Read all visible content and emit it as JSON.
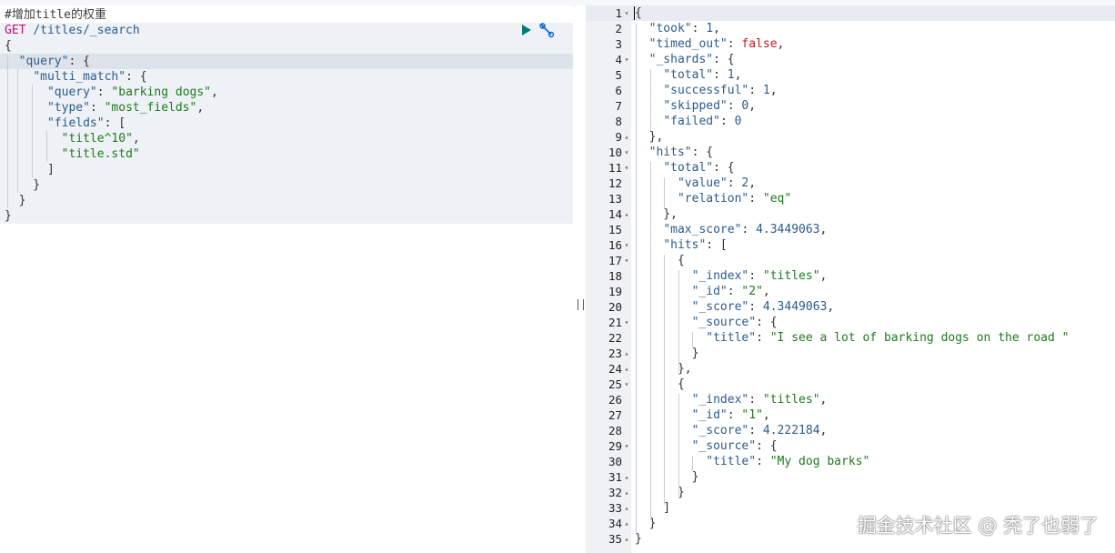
{
  "request": {
    "comment": "#增加title的权重",
    "method": "GET",
    "path": "/titles/_search",
    "body": [
      {
        "t": [
          [
            "{",
            "punc"
          ]
        ]
      },
      {
        "t": [
          [
            "  ",
            "punc"
          ],
          [
            "\"query\"",
            "key"
          ],
          [
            ": {",
            "punc"
          ]
        ]
      },
      {
        "t": [
          [
            "    ",
            "punc"
          ],
          [
            "\"multi_match\"",
            "key"
          ],
          [
            ": {",
            "punc"
          ]
        ]
      },
      {
        "t": [
          [
            "      ",
            "punc"
          ],
          [
            "\"query\"",
            "key"
          ],
          [
            ": ",
            "punc"
          ],
          [
            "\"barking dogs\"",
            "str"
          ],
          [
            ",",
            "punc"
          ]
        ]
      },
      {
        "t": [
          [
            "      ",
            "punc"
          ],
          [
            "\"type\"",
            "key"
          ],
          [
            ": ",
            "punc"
          ],
          [
            "\"most_fields\"",
            "str"
          ],
          [
            ",",
            "punc"
          ]
        ]
      },
      {
        "t": [
          [
            "      ",
            "punc"
          ],
          [
            "\"fields\"",
            "key"
          ],
          [
            ": [",
            "punc"
          ]
        ]
      },
      {
        "t": [
          [
            "        ",
            "punc"
          ],
          [
            "\"title^10\"",
            "str"
          ],
          [
            ",",
            "punc"
          ]
        ]
      },
      {
        "t": [
          [
            "        ",
            "punc"
          ],
          [
            "\"title.std\"",
            "str"
          ]
        ]
      },
      {
        "t": [
          [
            "      ]",
            "punc"
          ]
        ]
      },
      {
        "t": [
          [
            "    }",
            "punc"
          ]
        ]
      },
      {
        "t": [
          [
            "  }",
            "punc"
          ]
        ]
      },
      {
        "t": [
          [
            "}",
            "punc"
          ]
        ]
      }
    ],
    "run_icon": "play-icon",
    "settings_icon": "wrench-icon"
  },
  "response": {
    "lines": [
      {
        "n": "1",
        "f": "down",
        "t": [
          [
            "{",
            "punc"
          ]
        ]
      },
      {
        "n": "2",
        "f": "",
        "t": [
          [
            "  ",
            "punc"
          ],
          [
            "\"took\"",
            "key"
          ],
          [
            ": ",
            "punc"
          ],
          [
            "1",
            "num"
          ],
          [
            ",",
            "punc"
          ]
        ]
      },
      {
        "n": "3",
        "f": "",
        "t": [
          [
            "  ",
            "punc"
          ],
          [
            "\"timed_out\"",
            "key"
          ],
          [
            ": ",
            "punc"
          ],
          [
            "false",
            "kw"
          ],
          [
            ",",
            "punc"
          ]
        ]
      },
      {
        "n": "4",
        "f": "down",
        "t": [
          [
            "  ",
            "punc"
          ],
          [
            "\"_shards\"",
            "key"
          ],
          [
            ": {",
            "punc"
          ]
        ]
      },
      {
        "n": "5",
        "f": "",
        "t": [
          [
            "    ",
            "punc"
          ],
          [
            "\"total\"",
            "key"
          ],
          [
            ": ",
            "punc"
          ],
          [
            "1",
            "num"
          ],
          [
            ",",
            "punc"
          ]
        ]
      },
      {
        "n": "6",
        "f": "",
        "t": [
          [
            "    ",
            "punc"
          ],
          [
            "\"successful\"",
            "key"
          ],
          [
            ": ",
            "punc"
          ],
          [
            "1",
            "num"
          ],
          [
            ",",
            "punc"
          ]
        ]
      },
      {
        "n": "7",
        "f": "",
        "t": [
          [
            "    ",
            "punc"
          ],
          [
            "\"skipped\"",
            "key"
          ],
          [
            ": ",
            "punc"
          ],
          [
            "0",
            "num"
          ],
          [
            ",",
            "punc"
          ]
        ]
      },
      {
        "n": "8",
        "f": "",
        "t": [
          [
            "    ",
            "punc"
          ],
          [
            "\"failed\"",
            "key"
          ],
          [
            ": ",
            "punc"
          ],
          [
            "0",
            "num"
          ]
        ]
      },
      {
        "n": "9",
        "f": "up",
        "t": [
          [
            "  },",
            "punc"
          ]
        ]
      },
      {
        "n": "10",
        "f": "down",
        "t": [
          [
            "  ",
            "punc"
          ],
          [
            "\"hits\"",
            "key"
          ],
          [
            ": {",
            "punc"
          ]
        ]
      },
      {
        "n": "11",
        "f": "down",
        "t": [
          [
            "    ",
            "punc"
          ],
          [
            "\"total\"",
            "key"
          ],
          [
            ": {",
            "punc"
          ]
        ]
      },
      {
        "n": "12",
        "f": "",
        "t": [
          [
            "      ",
            "punc"
          ],
          [
            "\"value\"",
            "key"
          ],
          [
            ": ",
            "punc"
          ],
          [
            "2",
            "num"
          ],
          [
            ",",
            "punc"
          ]
        ]
      },
      {
        "n": "13",
        "f": "",
        "t": [
          [
            "      ",
            "punc"
          ],
          [
            "\"relation\"",
            "key"
          ],
          [
            ": ",
            "punc"
          ],
          [
            "\"eq\"",
            "str"
          ]
        ]
      },
      {
        "n": "14",
        "f": "up",
        "t": [
          [
            "    },",
            "punc"
          ]
        ]
      },
      {
        "n": "15",
        "f": "",
        "t": [
          [
            "    ",
            "punc"
          ],
          [
            "\"max_score\"",
            "key"
          ],
          [
            ": ",
            "punc"
          ],
          [
            "4.3449063",
            "num"
          ],
          [
            ",",
            "punc"
          ]
        ]
      },
      {
        "n": "16",
        "f": "down",
        "t": [
          [
            "    ",
            "punc"
          ],
          [
            "\"hits\"",
            "key"
          ],
          [
            ": [",
            "punc"
          ]
        ]
      },
      {
        "n": "17",
        "f": "down",
        "t": [
          [
            "      {",
            "punc"
          ]
        ]
      },
      {
        "n": "18",
        "f": "",
        "t": [
          [
            "        ",
            "punc"
          ],
          [
            "\"_index\"",
            "key"
          ],
          [
            ": ",
            "punc"
          ],
          [
            "\"titles\"",
            "str"
          ],
          [
            ",",
            "punc"
          ]
        ]
      },
      {
        "n": "19",
        "f": "",
        "t": [
          [
            "        ",
            "punc"
          ],
          [
            "\"_id\"",
            "key"
          ],
          [
            ": ",
            "punc"
          ],
          [
            "\"2\"",
            "str"
          ],
          [
            ",",
            "punc"
          ]
        ]
      },
      {
        "n": "20",
        "f": "",
        "t": [
          [
            "        ",
            "punc"
          ],
          [
            "\"_score\"",
            "key"
          ],
          [
            ": ",
            "punc"
          ],
          [
            "4.3449063",
            "num"
          ],
          [
            ",",
            "punc"
          ]
        ]
      },
      {
        "n": "21",
        "f": "down",
        "t": [
          [
            "        ",
            "punc"
          ],
          [
            "\"_source\"",
            "key"
          ],
          [
            ": {",
            "punc"
          ]
        ]
      },
      {
        "n": "22",
        "f": "",
        "t": [
          [
            "          ",
            "punc"
          ],
          [
            "\"title\"",
            "key"
          ],
          [
            ": ",
            "punc"
          ],
          [
            "\"I see a lot of barking dogs on the road \"",
            "str"
          ]
        ]
      },
      {
        "n": "23",
        "f": "up",
        "t": [
          [
            "        }",
            "punc"
          ]
        ]
      },
      {
        "n": "24",
        "f": "up",
        "t": [
          [
            "      },",
            "punc"
          ]
        ]
      },
      {
        "n": "25",
        "f": "down",
        "t": [
          [
            "      {",
            "punc"
          ]
        ]
      },
      {
        "n": "26",
        "f": "",
        "t": [
          [
            "        ",
            "punc"
          ],
          [
            "\"_index\"",
            "key"
          ],
          [
            ": ",
            "punc"
          ],
          [
            "\"titles\"",
            "str"
          ],
          [
            ",",
            "punc"
          ]
        ]
      },
      {
        "n": "27",
        "f": "",
        "t": [
          [
            "        ",
            "punc"
          ],
          [
            "\"_id\"",
            "key"
          ],
          [
            ": ",
            "punc"
          ],
          [
            "\"1\"",
            "str"
          ],
          [
            ",",
            "punc"
          ]
        ]
      },
      {
        "n": "28",
        "f": "",
        "t": [
          [
            "        ",
            "punc"
          ],
          [
            "\"_score\"",
            "key"
          ],
          [
            ": ",
            "punc"
          ],
          [
            "4.222184",
            "num"
          ],
          [
            ",",
            "punc"
          ]
        ]
      },
      {
        "n": "29",
        "f": "down",
        "t": [
          [
            "        ",
            "punc"
          ],
          [
            "\"_source\"",
            "key"
          ],
          [
            ": {",
            "punc"
          ]
        ]
      },
      {
        "n": "30",
        "f": "",
        "t": [
          [
            "          ",
            "punc"
          ],
          [
            "\"title\"",
            "key"
          ],
          [
            ": ",
            "punc"
          ],
          [
            "\"My dog barks\"",
            "str"
          ]
        ]
      },
      {
        "n": "31",
        "f": "up",
        "t": [
          [
            "        }",
            "punc"
          ]
        ]
      },
      {
        "n": "32",
        "f": "up",
        "t": [
          [
            "      }",
            "punc"
          ]
        ]
      },
      {
        "n": "33",
        "f": "up",
        "t": [
          [
            "    ]",
            "punc"
          ]
        ]
      },
      {
        "n": "34",
        "f": "up",
        "t": [
          [
            "  }",
            "punc"
          ]
        ]
      },
      {
        "n": "35",
        "f": "up",
        "t": [
          [
            "}",
            "punc"
          ]
        ]
      }
    ]
  },
  "watermark": "掘金技术社区 @ 秃了也弱了"
}
